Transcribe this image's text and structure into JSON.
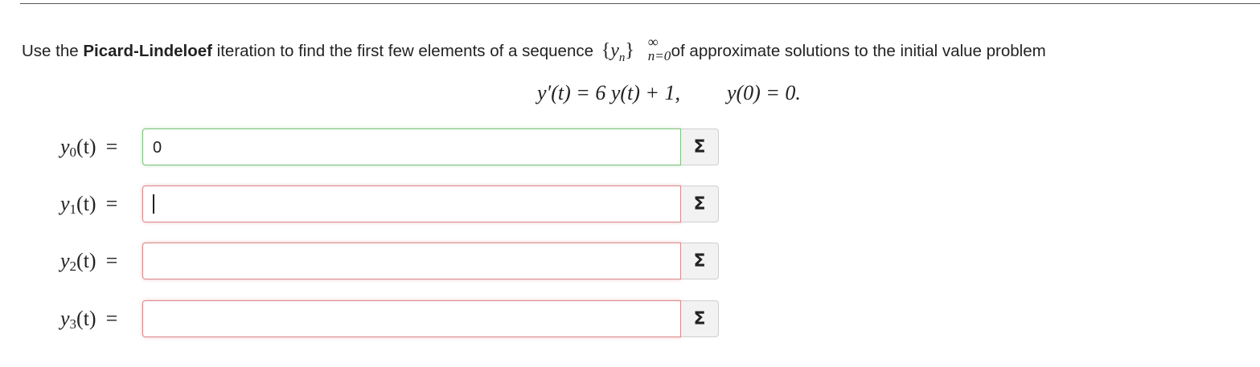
{
  "prompt": {
    "before": "Use the ",
    "method": "Picard-Lindeloef",
    "middle": " iteration to find the first few elements of a sequence ",
    "seq_open": "{",
    "seq_var": "y",
    "seq_var_sub": "n",
    "seq_close": "}",
    "seq_sup": "∞",
    "seq_sub": "n=0",
    "after": " of approximate solutions to the initial value problem"
  },
  "ivp": {
    "ode": "y′(t) = 6 y(t) + 1,",
    "initial_condition": "y(0) = 0."
  },
  "rows": [
    {
      "var": "y",
      "index": "0",
      "arg": "(t)",
      "eq": "=",
      "value": "0",
      "status": "correct"
    },
    {
      "var": "y",
      "index": "1",
      "arg": "(t)",
      "eq": "=",
      "value": "",
      "status": "incorrect"
    },
    {
      "var": "y",
      "index": "2",
      "arg": "(t)",
      "eq": "=",
      "value": "",
      "status": "incorrect"
    },
    {
      "var": "y",
      "index": "3",
      "arg": "(t)",
      "eq": "=",
      "value": "",
      "status": "incorrect"
    }
  ],
  "sigma_label": "Σ",
  "icons": {
    "sigma_button": "sigma-icon",
    "text_cursor": "text-cursor"
  },
  "colors": {
    "correct_border": "#7cc27c",
    "incorrect_border": "#d98a8a"
  }
}
